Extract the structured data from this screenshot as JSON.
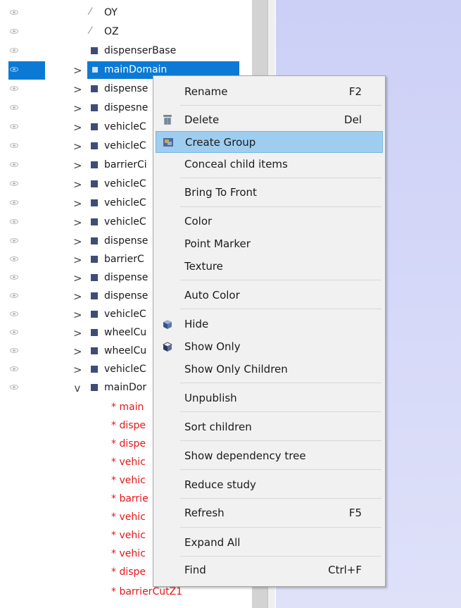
{
  "tree": {
    "rows": [
      {
        "label": "OY",
        "icon": "axis-icon",
        "expander": ""
      },
      {
        "label": "OZ",
        "icon": "axis-icon",
        "expander": ""
      },
      {
        "label": "dispenserBase",
        "icon": "mesh-icon",
        "expander": ""
      },
      {
        "label": "mainDomain",
        "icon": "mesh-icon",
        "expander": ">",
        "selected": true
      },
      {
        "label": "dispense",
        "icon": "mesh-icon",
        "expander": ">"
      },
      {
        "label": "dispesne",
        "icon": "mesh-icon",
        "expander": ">"
      },
      {
        "label": "vehicleC",
        "icon": "mesh-icon",
        "expander": ">"
      },
      {
        "label": "vehicleC",
        "icon": "mesh-icon",
        "expander": ">"
      },
      {
        "label": "barrierCi",
        "icon": "mesh-icon",
        "expander": ">"
      },
      {
        "label": "vehicleC",
        "icon": "mesh-icon",
        "expander": ">"
      },
      {
        "label": "vehicleC",
        "icon": "mesh-icon",
        "expander": ">"
      },
      {
        "label": "vehicleC",
        "icon": "mesh-icon",
        "expander": ">"
      },
      {
        "label": "dispense",
        "icon": "mesh-icon",
        "expander": ">"
      },
      {
        "label": "barrierC",
        "icon": "mesh-icon",
        "expander": ">"
      },
      {
        "label": "dispense",
        "icon": "mesh-icon",
        "expander": ">"
      },
      {
        "label": "dispense",
        "icon": "mesh-icon",
        "expander": ">"
      },
      {
        "label": "vehicleC",
        "icon": "mesh-icon",
        "expander": ">"
      },
      {
        "label": "wheelCu",
        "icon": "mesh-icon",
        "expander": ">"
      },
      {
        "label": "wheelCu",
        "icon": "mesh-icon",
        "expander": ">"
      },
      {
        "label": "vehicleC",
        "icon": "mesh-icon",
        "expander": ">"
      },
      {
        "label": "mainDor",
        "icon": "mesh-icon",
        "expander": "v",
        "expanded": true
      }
    ],
    "children": [
      "* main",
      "* dispe",
      "* dispe",
      "* vehic",
      "* vehic",
      "* barrie",
      "* vehic",
      "* vehic",
      "* vehic",
      "* dispe",
      "* barrierCutZ1"
    ]
  },
  "context_menu": {
    "items": [
      {
        "label": "Rename",
        "shortcut": "F2",
        "icon": ""
      },
      {
        "label": "Delete",
        "shortcut": "Del",
        "icon": "trash-icon"
      },
      {
        "label": "Create Group",
        "shortcut": "",
        "icon": "group-icon",
        "highlighted": true
      },
      {
        "label": "Conceal child items",
        "shortcut": "",
        "icon": ""
      },
      {
        "label": "Bring To Front",
        "shortcut": "",
        "icon": ""
      },
      {
        "label": "Color",
        "shortcut": "",
        "icon": ""
      },
      {
        "label": "Point Marker",
        "shortcut": "",
        "icon": ""
      },
      {
        "label": "Texture",
        "shortcut": "",
        "icon": ""
      },
      {
        "label": "Auto Color",
        "shortcut": "",
        "icon": ""
      },
      {
        "label": "Hide",
        "shortcut": "",
        "icon": "hide-cube-icon"
      },
      {
        "label": "Show Only",
        "shortcut": "",
        "icon": "show-cube-icon"
      },
      {
        "label": "Show Only Children",
        "shortcut": "",
        "icon": ""
      },
      {
        "label": "Unpublish",
        "shortcut": "",
        "icon": ""
      },
      {
        "label": "Sort children",
        "shortcut": "",
        "icon": ""
      },
      {
        "label": "Show dependency tree",
        "shortcut": "",
        "icon": ""
      },
      {
        "label": "Reduce study",
        "shortcut": "",
        "icon": ""
      },
      {
        "label": "Refresh",
        "shortcut": "F5",
        "icon": ""
      },
      {
        "label": "Expand All",
        "shortcut": "",
        "icon": ""
      },
      {
        "label": "Find",
        "shortcut": "Ctrl+F",
        "icon": ""
      }
    ]
  },
  "colors": {
    "selection": "#0c7ad4",
    "menu_highlight": "#9ecdef",
    "child_text": "#e4161b",
    "viewport_bg": "#ccd0f6"
  }
}
